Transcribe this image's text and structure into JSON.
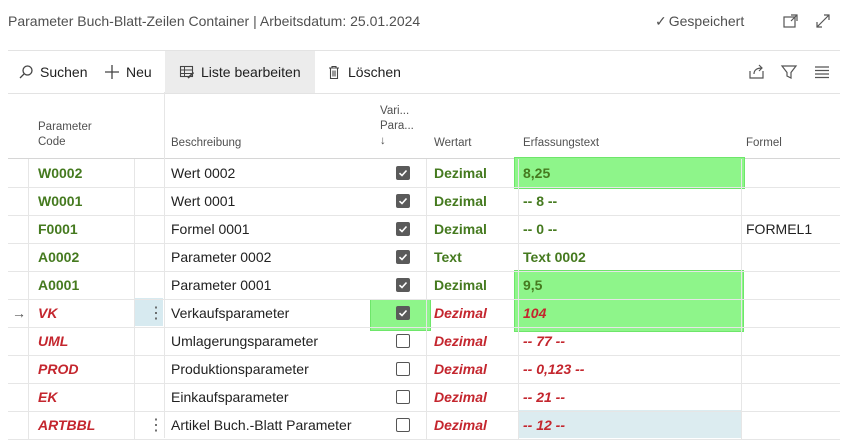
{
  "window": {
    "title": "Parameter Buch-Blatt-Zeilen Container | Arbeitsdatum: 25.01.2024",
    "saved_label": "Gespeichert"
  },
  "toolbar": {
    "search_label": "Suchen",
    "new_label": "Neu",
    "edit_list_label": "Liste bearbeiten",
    "delete_label": "Löschen"
  },
  "columns": {
    "code_line1": "Parameter",
    "code_line2": "Code",
    "description": "Beschreibung",
    "var_line1": "Vari...",
    "var_line2": "Para...",
    "var_sort": "↓",
    "value_type": "Wertart",
    "entry_text": "Erfassungstext",
    "formula": "Formel"
  },
  "rows": [
    {
      "code": "W0002",
      "description": "Wert 0002",
      "checked": true,
      "value_type": "Dezimal",
      "entry_text": "8,25",
      "formula": "",
      "style": "green"
    },
    {
      "code": "W0001",
      "description": "Wert 0001",
      "checked": true,
      "value_type": "Dezimal",
      "entry_text": "-- 8 --",
      "formula": "",
      "style": "green"
    },
    {
      "code": "F0001",
      "description": "Formel 0001",
      "checked": true,
      "value_type": "Dezimal",
      "entry_text": "-- 0 --",
      "formula": "FORMEL1",
      "style": "green"
    },
    {
      "code": "A0002",
      "description": "Parameter 0002",
      "checked": true,
      "value_type": "Text",
      "entry_text": "Text 0002",
      "formula": "",
      "style": "green"
    },
    {
      "code": "A0001",
      "description": "Parameter 0001",
      "checked": true,
      "value_type": "Dezimal",
      "entry_text": "9,5",
      "formula": "",
      "style": "green"
    },
    {
      "code": "VK",
      "description": "Verkaufsparameter",
      "checked": true,
      "value_type": "Dezimal",
      "entry_text": "104",
      "formula": "",
      "style": "red"
    },
    {
      "code": "UML",
      "description": "Umlagerungsparameter",
      "checked": false,
      "value_type": "Dezimal",
      "entry_text": "-- 77 --",
      "formula": "",
      "style": "red"
    },
    {
      "code": "PROD",
      "description": "Produktionsparameter",
      "checked": false,
      "value_type": "Dezimal",
      "entry_text": "-- 0,123 --",
      "formula": "",
      "style": "red"
    },
    {
      "code": "EK",
      "description": "Einkaufsparameter",
      "checked": false,
      "value_type": "Dezimal",
      "entry_text": "-- 21 --",
      "formula": "",
      "style": "red"
    },
    {
      "code": "ARTBBL",
      "description": "Artikel Buch.-Blatt Parameter",
      "checked": false,
      "value_type": "Dezimal",
      "entry_text": "-- 12 --",
      "formula": "",
      "style": "red"
    }
  ],
  "current_row_marker": "→",
  "row_menu_glyph": "⋮",
  "colors": {
    "green_code": "#457a1f",
    "red_code": "#c4262e",
    "highlight": "#8ef58a"
  }
}
